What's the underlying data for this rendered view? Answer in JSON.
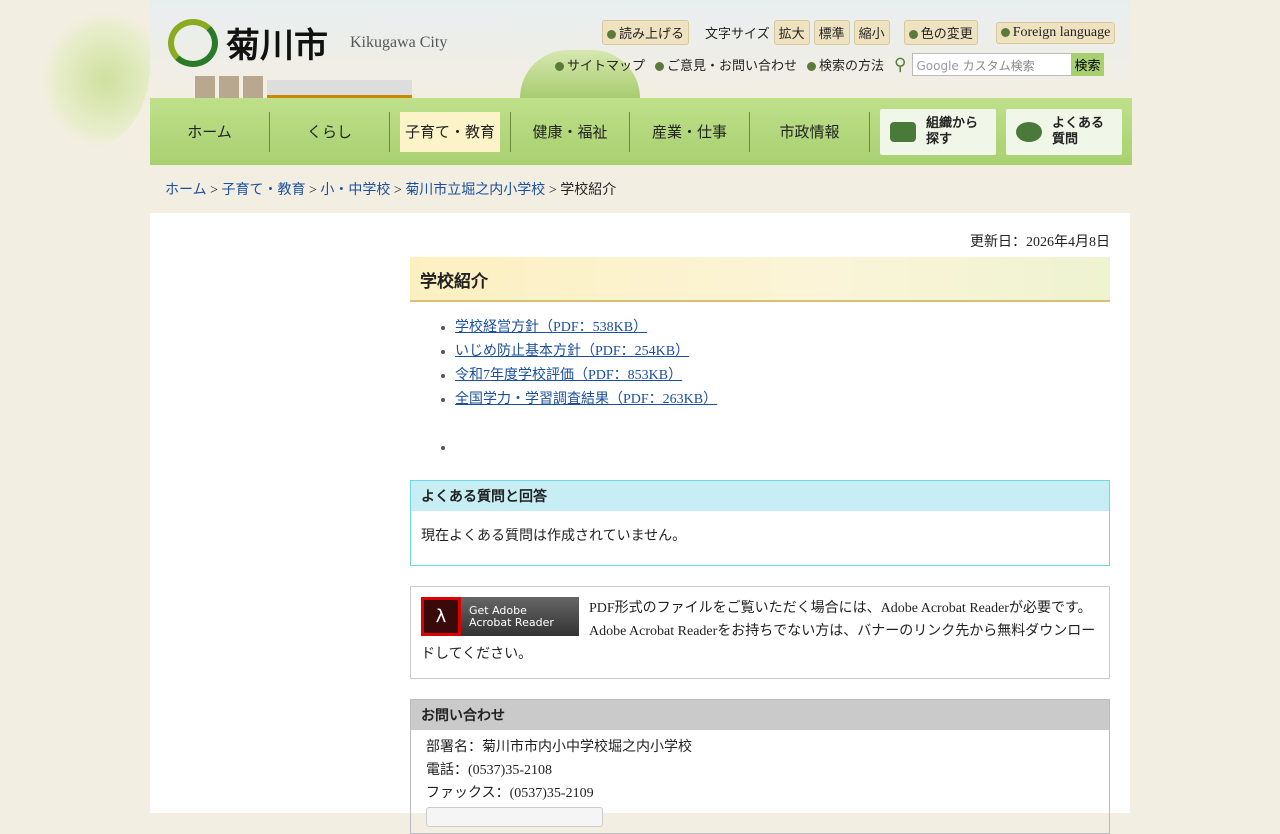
{
  "header": {
    "logo_text": "菊川市",
    "logo_en": "Kikugawa City"
  },
  "toolbar": {
    "read_aloud": "読み上げる",
    "font_size_label": "文字サイズ",
    "enlarge": "拡大",
    "standard": "標準",
    "shrink": "縮小",
    "color_change": "色の変更",
    "foreign": "Foreign language",
    "sitemap": "サイトマップ",
    "contact": "ご意見・お問い合わせ",
    "search_help": "検索の方法",
    "search_placeholder": "カスタム検索",
    "search_brand": "Google",
    "search_button": "検索"
  },
  "nav": {
    "items": [
      "ホーム",
      "くらし",
      "子育て・教育",
      "健康・福祉",
      "産業・仕事",
      "市政情報"
    ],
    "org": "組織から探す",
    "faq": "よくある質問"
  },
  "breadcrumb": [
    "ホーム",
    "子育て・教育",
    "小・中学校",
    "菊川市立堀之内小学校"
  ],
  "breadcrumb_current": "学校紹介",
  "page": {
    "updated": "更新日：2026年4月8日",
    "title": "学校紹介",
    "links": [
      "学校経営方針（PDF：538KB）",
      "いじめ防止基本方針（PDF：254KB）",
      "令和7年度学校評価（PDF：853KB）",
      "全国学力・学習調査結果（PDF：263KB）"
    ],
    "faq_title": "よくある質問と回答",
    "faq_body": "現在よくある質問は作成されていません。",
    "adobe_banner": "Get Adobe Acrobat Reader",
    "pdf_note": "PDF形式のファイルをご覧いただく場合には、Adobe Acrobat Readerが必要です。Adobe Acrobat Readerをお持ちでない方は、バナーのリンク先から無料ダウンロードしてください。",
    "contact_title": "お問い合わせ",
    "dept": "部署名：菊川市市内小中学校堀之内小学校",
    "tel": "電話：(0537)35-2108",
    "fax": "ファックス：(0537)35-2109"
  }
}
